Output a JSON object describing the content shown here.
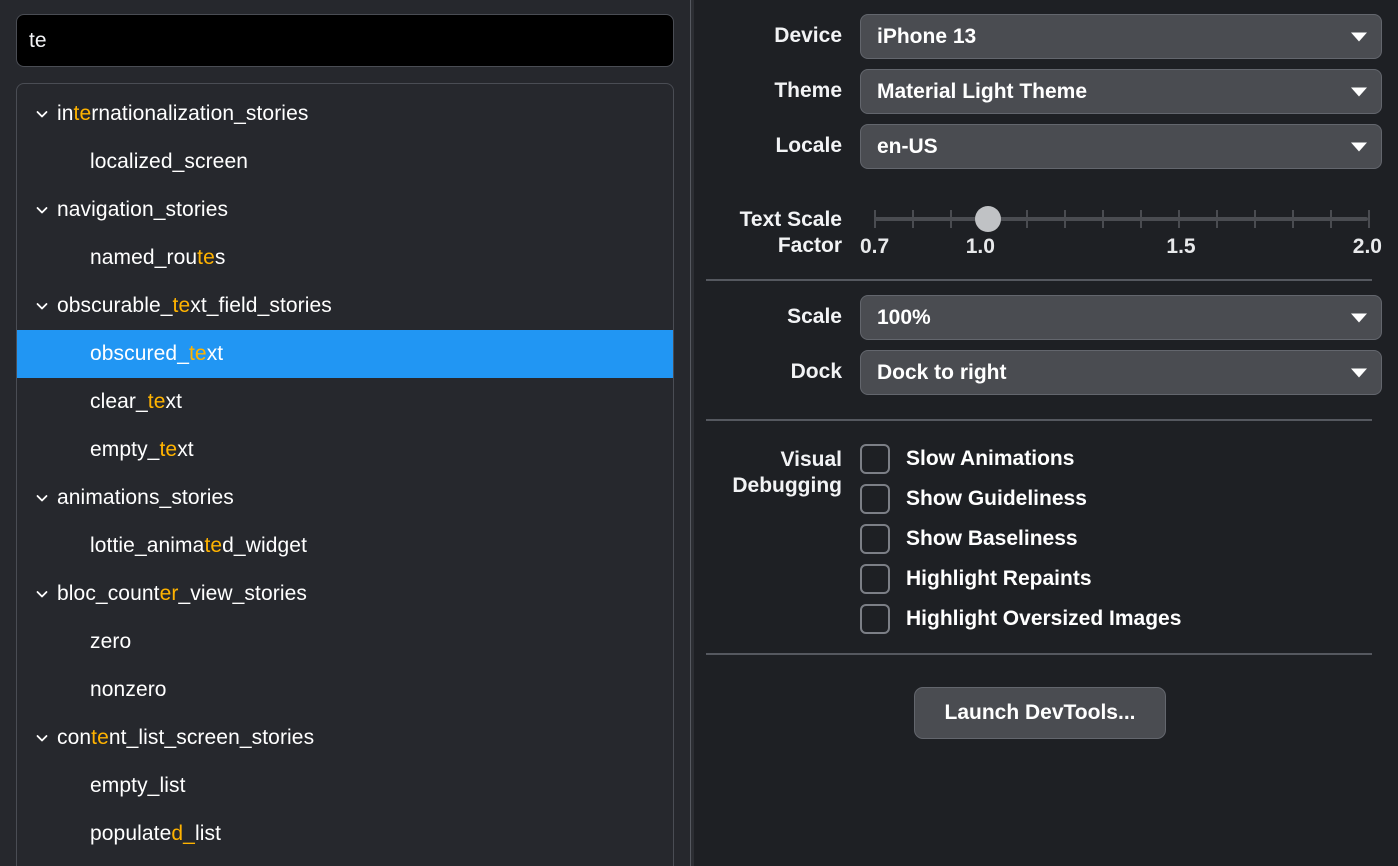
{
  "search": {
    "value": "te",
    "placeholder": ""
  },
  "tree": {
    "items": [
      {
        "label": "internationalization_stories",
        "type": "folder",
        "expanded": true,
        "selected": false,
        "match": {
          "start": 2,
          "len": 2
        }
      },
      {
        "label": "localized_screen",
        "type": "leaf",
        "expanded": false,
        "selected": false,
        "match": null
      },
      {
        "label": "navigation_stories",
        "type": "folder",
        "expanded": true,
        "selected": false,
        "match": null
      },
      {
        "label": "named_routes",
        "type": "leaf",
        "expanded": false,
        "selected": false,
        "match": {
          "start": 9,
          "len": 2
        }
      },
      {
        "label": "obscurable_text_field_stories",
        "type": "folder",
        "expanded": true,
        "selected": false,
        "match": {
          "start": 11,
          "len": 2
        }
      },
      {
        "label": "obscured_text",
        "type": "leaf",
        "expanded": false,
        "selected": true,
        "match": {
          "start": 9,
          "len": 2
        }
      },
      {
        "label": "clear_text",
        "type": "leaf",
        "expanded": false,
        "selected": false,
        "match": {
          "start": 6,
          "len": 2
        }
      },
      {
        "label": "empty_text",
        "type": "leaf",
        "expanded": false,
        "selected": false,
        "match": {
          "start": 6,
          "len": 2
        }
      },
      {
        "label": "animations_stories",
        "type": "folder",
        "expanded": true,
        "selected": false,
        "match": null
      },
      {
        "label": "lottie_animated_widget",
        "type": "leaf",
        "expanded": false,
        "selected": false,
        "match": {
          "start": 12,
          "len": 2
        }
      },
      {
        "label": "bloc_counter_view_stories",
        "type": "folder",
        "expanded": true,
        "selected": false,
        "match": {
          "start": 10,
          "len": 2
        }
      },
      {
        "label": "zero",
        "type": "leaf",
        "expanded": false,
        "selected": false,
        "match": null
      },
      {
        "label": "nonzero",
        "type": "leaf",
        "expanded": false,
        "selected": false,
        "match": null
      },
      {
        "label": "content_list_screen_stories",
        "type": "folder",
        "expanded": true,
        "selected": false,
        "match": {
          "start": 3,
          "len": 2
        }
      },
      {
        "label": "empty_list",
        "type": "leaf",
        "expanded": false,
        "selected": false,
        "match": null
      },
      {
        "label": "populated_list",
        "type": "leaf",
        "expanded": false,
        "selected": false,
        "match": {
          "start": 8,
          "len": 2
        }
      }
    ]
  },
  "settings": {
    "device": {
      "label": "Device",
      "value": "iPhone 13"
    },
    "theme": {
      "label": "Theme",
      "value": "Material Light Theme"
    },
    "locale": {
      "label": "Locale",
      "value": "en-US"
    },
    "text_scale_factor": {
      "label_line1": "Text Scale",
      "label_line2": "Factor",
      "value": 1.0,
      "min": 0.7,
      "max": 2.0,
      "tick_count": 14,
      "scale_labels": [
        "0.7",
        "1.0",
        "1.5",
        "2.0"
      ]
    },
    "scale": {
      "label": "Scale",
      "value": "100%"
    },
    "dock": {
      "label": "Dock",
      "value": "Dock to right"
    }
  },
  "visual_debugging": {
    "label_line1": "Visual",
    "label_line2": "Debugging",
    "options": [
      {
        "label": "Slow Animations",
        "checked": false
      },
      {
        "label": "Show Guideliness",
        "checked": false
      },
      {
        "label": "Show Baseliness",
        "checked": false
      },
      {
        "label": "Highlight Repaints",
        "checked": false
      },
      {
        "label": "Highlight Oversized Images",
        "checked": false
      }
    ]
  },
  "actions": {
    "launch_devtools": "Launch DevTools..."
  },
  "colors": {
    "selection_blue": "#2196f3",
    "match_orange": "#ffb300",
    "left_panel_bg": "#26282d",
    "right_panel_bg": "#1e2024",
    "control_bg": "#4a4c51"
  }
}
